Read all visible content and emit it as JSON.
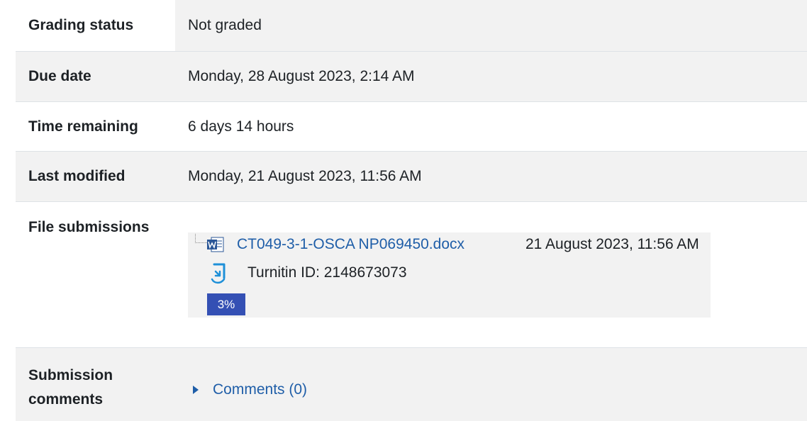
{
  "rows": {
    "grading_status": {
      "label": "Grading status",
      "value": "Not graded"
    },
    "due_date": {
      "label": "Due date",
      "value": "Monday, 28 August 2023, 2:14 AM"
    },
    "time_remaining": {
      "label": "Time remaining",
      "value": "6 days 14 hours"
    },
    "last_modified": {
      "label": "Last modified",
      "value": "Monday, 21 August 2023, 11:56 AM"
    },
    "file_submissions": {
      "label": "File submissions",
      "file_name": "CT049-3-1-OSCA NP069450.docx",
      "file_date": "21 August 2023, 11:56 AM",
      "turnitin_id": "Turnitin ID: 2148673073",
      "similarity": "3%",
      "file_icon": "word-document-icon",
      "turnitin_icon": "turnitin-icon"
    },
    "submission_comments": {
      "label_line1": "Submission",
      "label_line2": "comments",
      "link": "Comments (0)"
    }
  },
  "colors": {
    "link": "#1f5ea8",
    "row_shade": "#f2f2f2",
    "badge": "#3450b4"
  }
}
